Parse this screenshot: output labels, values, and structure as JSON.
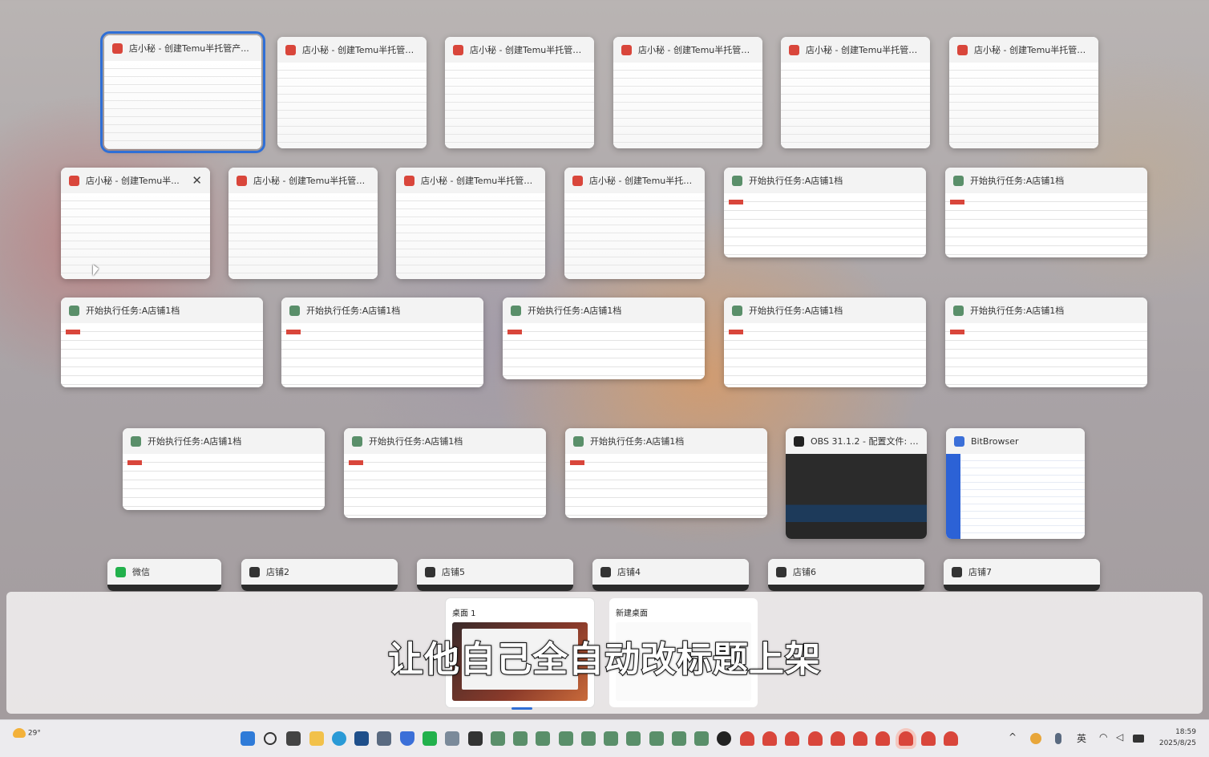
{
  "windows": [
    {
      "title": "店小秘 - 创建Temu半托管产...",
      "icon": "dianxiaomi-icon",
      "kind": "dxm",
      "selected": true
    },
    {
      "title": "店小秘 - 创建Temu半托管产...",
      "icon": "dianxiaomi-icon",
      "kind": "dxm"
    },
    {
      "title": "店小秘 - 创建Temu半托管产...",
      "icon": "dianxiaomi-icon",
      "kind": "dxm"
    },
    {
      "title": "店小秘 - 创建Temu半托管产...",
      "icon": "dianxiaomi-icon",
      "kind": "dxm"
    },
    {
      "title": "店小秘 - 创建Temu半托管产...",
      "icon": "dianxiaomi-icon",
      "kind": "dxm"
    },
    {
      "title": "店小秘 - 创建Temu半托管产...",
      "icon": "dianxiaomi-icon",
      "kind": "dxm"
    },
    {
      "title": "店小秘 - 创建Temu半...",
      "icon": "dianxiaomi-icon",
      "kind": "dxm",
      "close_label": "✕"
    },
    {
      "title": "店小秘 - 创建Temu半托管产...",
      "icon": "dianxiaomi-icon",
      "kind": "dxm"
    },
    {
      "title": "店小秘 - 创建Temu半托管产...",
      "icon": "dianxiaomi-icon",
      "kind": "dxm"
    },
    {
      "title": "店小秘 - 创建Temu半托管...",
      "icon": "dianxiaomi-icon",
      "kind": "dxm"
    },
    {
      "title": "开始执行任务:A店铺1档",
      "icon": "task-app-icon",
      "kind": "task"
    },
    {
      "title": "开始执行任务:A店铺1档",
      "icon": "task-app-icon",
      "kind": "task"
    },
    {
      "title": "开始执行任务:A店铺1档",
      "icon": "task-app-icon",
      "kind": "task"
    },
    {
      "title": "开始执行任务:A店铺1档",
      "icon": "task-app-icon",
      "kind": "task"
    },
    {
      "title": "开始执行任务:A店铺1档",
      "icon": "task-app-icon",
      "kind": "task"
    },
    {
      "title": "开始执行任务:A店铺1档",
      "icon": "task-app-icon",
      "kind": "task"
    },
    {
      "title": "开始执行任务:A店铺1档",
      "icon": "task-app-icon",
      "kind": "task"
    },
    {
      "title": "开始执行任务:A店铺1档",
      "icon": "task-app-icon",
      "kind": "task"
    },
    {
      "title": "开始执行任务:A店铺1档",
      "icon": "task-app-icon",
      "kind": "task"
    },
    {
      "title": "开始执行任务:A店铺1档",
      "icon": "task-app-icon",
      "kind": "task"
    },
    {
      "title": "OBS 31.1.2 - 配置文件: 未...",
      "icon": "obs-icon",
      "kind": "obs"
    },
    {
      "title": "BitBrowser",
      "icon": "bitbrowser-icon",
      "kind": "bit"
    },
    {
      "title": "微信",
      "icon": "wechat-icon",
      "kind": "dark"
    },
    {
      "title": "店铺2",
      "icon": "terminal-icon",
      "kind": "dark"
    },
    {
      "title": "店铺5",
      "icon": "terminal-icon",
      "kind": "dark"
    },
    {
      "title": "店铺4",
      "icon": "terminal-icon",
      "kind": "dark"
    },
    {
      "title": "店铺6",
      "icon": "terminal-icon",
      "kind": "dark"
    },
    {
      "title": "店铺7",
      "icon": "terminal-icon",
      "kind": "dark"
    }
  ],
  "desktops": [
    {
      "label": "桌面 1",
      "active": true
    },
    {
      "label": "新建桌面",
      "active": false
    }
  ],
  "subtitle": "让他自己全自动改标题上架",
  "taskbar": {
    "weather": "29°",
    "tray_lang": "英",
    "time": "18:59",
    "date": "2025/8/25"
  },
  "colors": {
    "accent": "#2f6fd6",
    "dianxiaomi": "#d9463b",
    "taskbar": "#ecebee"
  }
}
